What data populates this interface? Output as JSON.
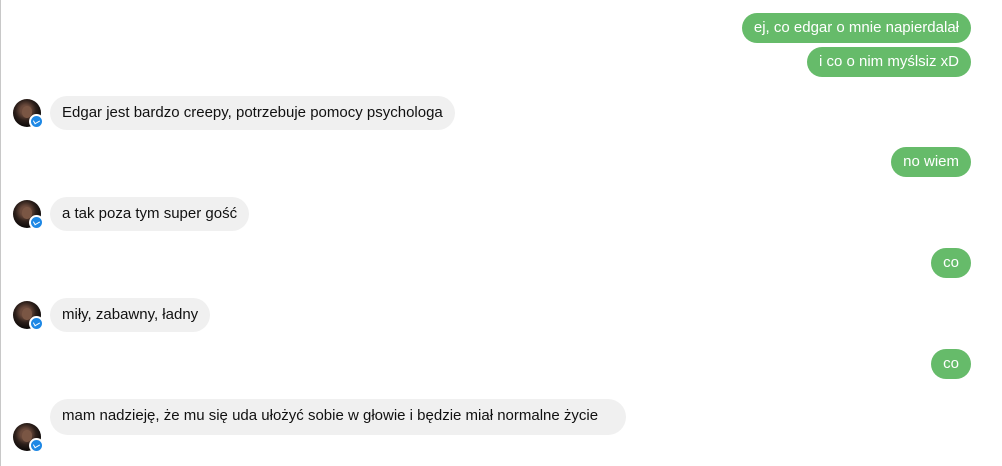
{
  "conversation": {
    "messages": [
      {
        "side": "out",
        "text": "ej, co edgar o mnie napierdalał"
      },
      {
        "side": "out",
        "text": "i co o nim myślsiz xD"
      },
      {
        "side": "in",
        "text": "Edgar jest bardzo creepy, potrzebuje pomocy psychologa"
      },
      {
        "side": "out",
        "text": "no wiem"
      },
      {
        "side": "in",
        "text": "a tak poza tym super gość"
      },
      {
        "side": "out",
        "text": "co"
      },
      {
        "side": "in",
        "text": "miły, zabawny, ładny"
      },
      {
        "side": "out",
        "text": "co"
      },
      {
        "side": "in",
        "text": "mam nadzieję, że mu się uda ułożyć sobie w głowie i będzie miał normalne życie"
      }
    ]
  },
  "colors": {
    "outgoing_bubble": "#66bb6a",
    "incoming_bubble": "#f0f0f0",
    "messenger_badge": "#1e88e5"
  },
  "icons": {
    "avatar": "contact-avatar",
    "badge": "messenger-badge-icon"
  }
}
